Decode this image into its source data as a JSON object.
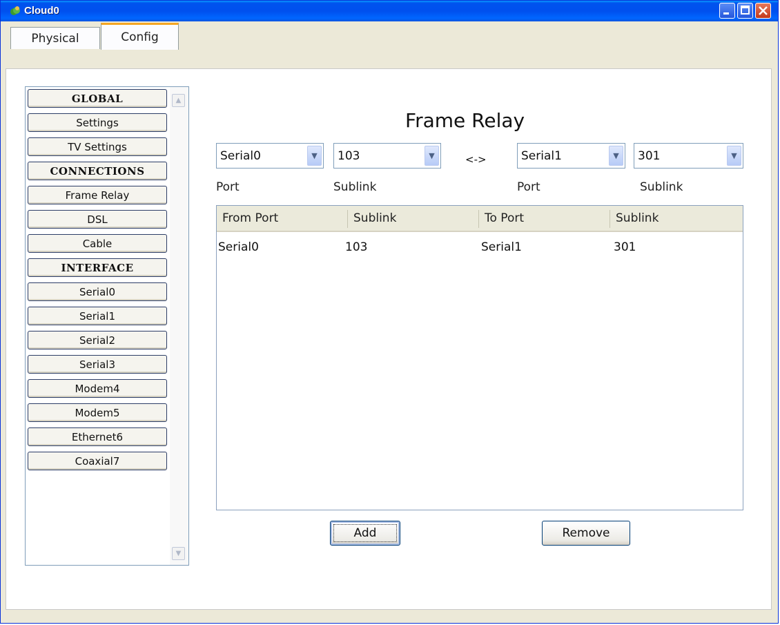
{
  "window": {
    "title": "Cloud0",
    "colors": {
      "titlebar": "#0053ee",
      "tab_accent": "#f5a623",
      "close": "#c2391b"
    }
  },
  "tabs": [
    {
      "label": "Physical",
      "active": false
    },
    {
      "label": "Config",
      "active": true
    }
  ],
  "sidebar": {
    "items": [
      {
        "label": "GLOBAL",
        "header": true
      },
      {
        "label": "Settings",
        "header": false
      },
      {
        "label": "TV Settings",
        "header": false
      },
      {
        "label": "CONNECTIONS",
        "header": true
      },
      {
        "label": "Frame Relay",
        "header": false
      },
      {
        "label": "DSL",
        "header": false
      },
      {
        "label": "Cable",
        "header": false
      },
      {
        "label": "INTERFACE",
        "header": true
      },
      {
        "label": "Serial0",
        "header": false
      },
      {
        "label": "Serial1",
        "header": false
      },
      {
        "label": "Serial2",
        "header": false
      },
      {
        "label": "Serial3",
        "header": false
      },
      {
        "label": "Modem4",
        "header": false
      },
      {
        "label": "Modem5",
        "header": false
      },
      {
        "label": "Ethernet6",
        "header": false
      },
      {
        "label": "Coaxial7",
        "header": false
      }
    ]
  },
  "main": {
    "title": "Frame Relay",
    "from_port": "Serial0",
    "from_sublink": "103",
    "separator": "<->",
    "to_port": "Serial1",
    "to_sublink": "301",
    "labels": {
      "port": "Port",
      "sublink": "Sublink"
    },
    "table": {
      "columns": [
        "From Port",
        "Sublink",
        "To Port",
        "Sublink"
      ],
      "rows": [
        [
          "Serial0",
          "103",
          "Serial1",
          "301"
        ]
      ]
    },
    "add_label": "Add",
    "remove_label": "Remove"
  }
}
